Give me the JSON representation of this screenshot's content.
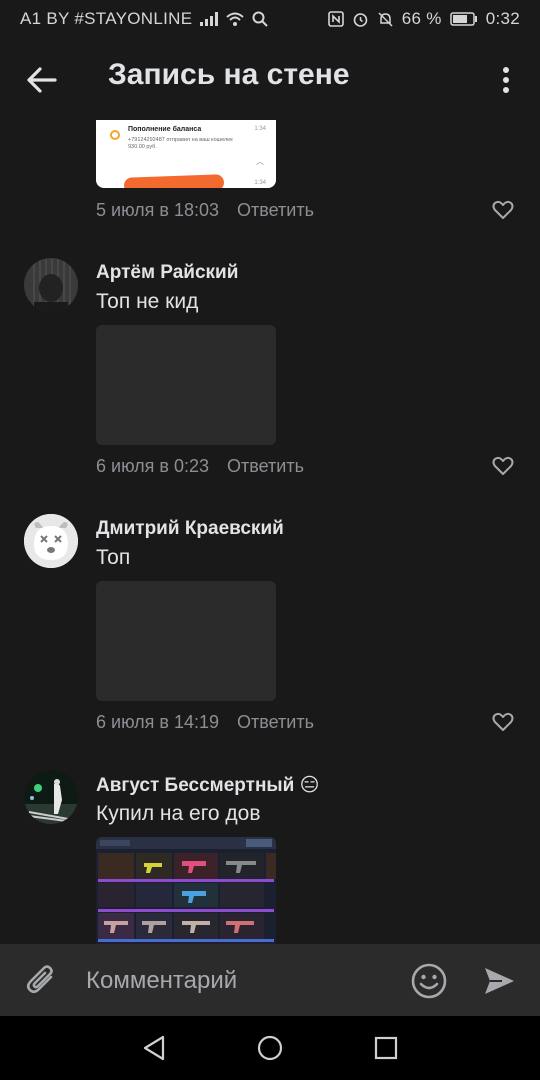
{
  "status_bar": {
    "carrier": "A1 BY #STAYONLINE",
    "battery_percent": "66 %",
    "time": "0:32"
  },
  "header": {
    "title": "Запись на стене"
  },
  "first_attachment": {
    "notification_title": "Пополнение баланса",
    "notification_time": "1:34",
    "notification_body": "+79124292487 отправил на ваш кошелек 930.00 руб.",
    "notification_time_bottom": "1:34"
  },
  "first_meta": {
    "date": "5 июля в 18:03",
    "reply": "Ответить"
  },
  "comments": [
    {
      "author": "Артём Райский",
      "text": "Топ не кид",
      "date": "6 июля в 0:23",
      "reply": "Ответить"
    },
    {
      "author": "Дмитрий Краевский",
      "text": "Топ",
      "date": "6 июля в 14:19",
      "reply": "Ответить"
    },
    {
      "author": "Август Бессмертный",
      "author_emoji": "😑",
      "text": "Купил на его дов"
    }
  ],
  "composer": {
    "placeholder": "Комментарий"
  },
  "colors": {
    "background": "#191919",
    "composer": "#2b2b2b",
    "text_primary": "#e1e3e6",
    "text_secondary": "#8b8f94"
  },
  "icons": [
    "back-arrow-icon",
    "more-vertical-icon",
    "heart-icon",
    "paperclip-icon",
    "smile-icon",
    "send-icon"
  ]
}
